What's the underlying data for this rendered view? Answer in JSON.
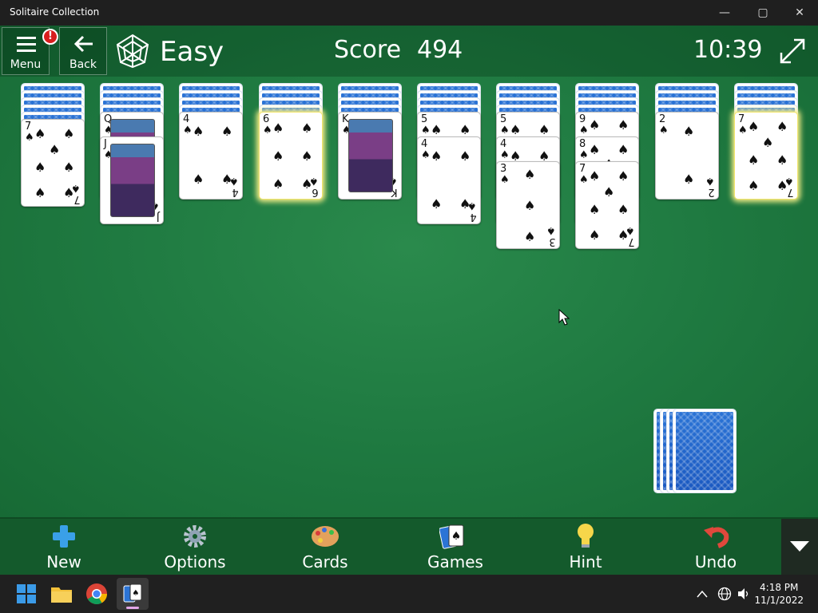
{
  "window": {
    "title": "Solitaire Collection",
    "minimize": "—",
    "maximize": "▢",
    "close": "✕"
  },
  "header": {
    "menu_label": "Menu",
    "badge": "!",
    "back_label": "Back",
    "difficulty": "Easy",
    "score_label": "Score",
    "score_value": "494",
    "timer": "10:39"
  },
  "tableau": [
    {
      "face_down": 5,
      "face_up": [
        {
          "rank": "7",
          "suit": "♠"
        }
      ]
    },
    {
      "face_down": 4,
      "face_up": [
        {
          "rank": "Q",
          "suit": "♠"
        },
        {
          "rank": "J",
          "suit": "♠"
        }
      ]
    },
    {
      "face_down": 4,
      "face_up": [
        {
          "rank": "4",
          "suit": "♠"
        }
      ]
    },
    {
      "face_down": 4,
      "face_up": [
        {
          "rank": "6",
          "suit": "♠"
        }
      ]
    },
    {
      "face_down": 4,
      "face_up": [
        {
          "rank": "K",
          "suit": "♠"
        }
      ]
    },
    {
      "face_down": 4,
      "face_up": [
        {
          "rank": "5",
          "suit": "♠"
        },
        {
          "rank": "4",
          "suit": "♠"
        }
      ]
    },
    {
      "face_down": 4,
      "face_up": [
        {
          "rank": "5",
          "suit": "♠"
        },
        {
          "rank": "4",
          "suit": "♠"
        },
        {
          "rank": "3",
          "suit": "♠"
        }
      ]
    },
    {
      "face_down": 4,
      "face_up": [
        {
          "rank": "9",
          "suit": "♠"
        },
        {
          "rank": "8",
          "suit": "♠"
        },
        {
          "rank": "7",
          "suit": "♠"
        }
      ]
    },
    {
      "face_down": 4,
      "face_up": [
        {
          "rank": "2",
          "suit": "♠"
        }
      ]
    },
    {
      "face_down": 4,
      "face_up": [
        {
          "rank": "7",
          "suit": "♠"
        }
      ]
    }
  ],
  "highlighted_columns": [
    3,
    9
  ],
  "stock_piles": 4,
  "toolbar": {
    "new": "New",
    "options": "Options",
    "cards": "Cards",
    "games": "Games",
    "hint": "Hint",
    "undo": "Undo"
  },
  "taskbar": {
    "time": "4:18 PM",
    "date": "11/1/2022"
  },
  "colors": {
    "felt": "#1f7a41",
    "toolbar": "#145a2c",
    "card_back": "#1a58c0",
    "badge": "#d81e1e"
  }
}
